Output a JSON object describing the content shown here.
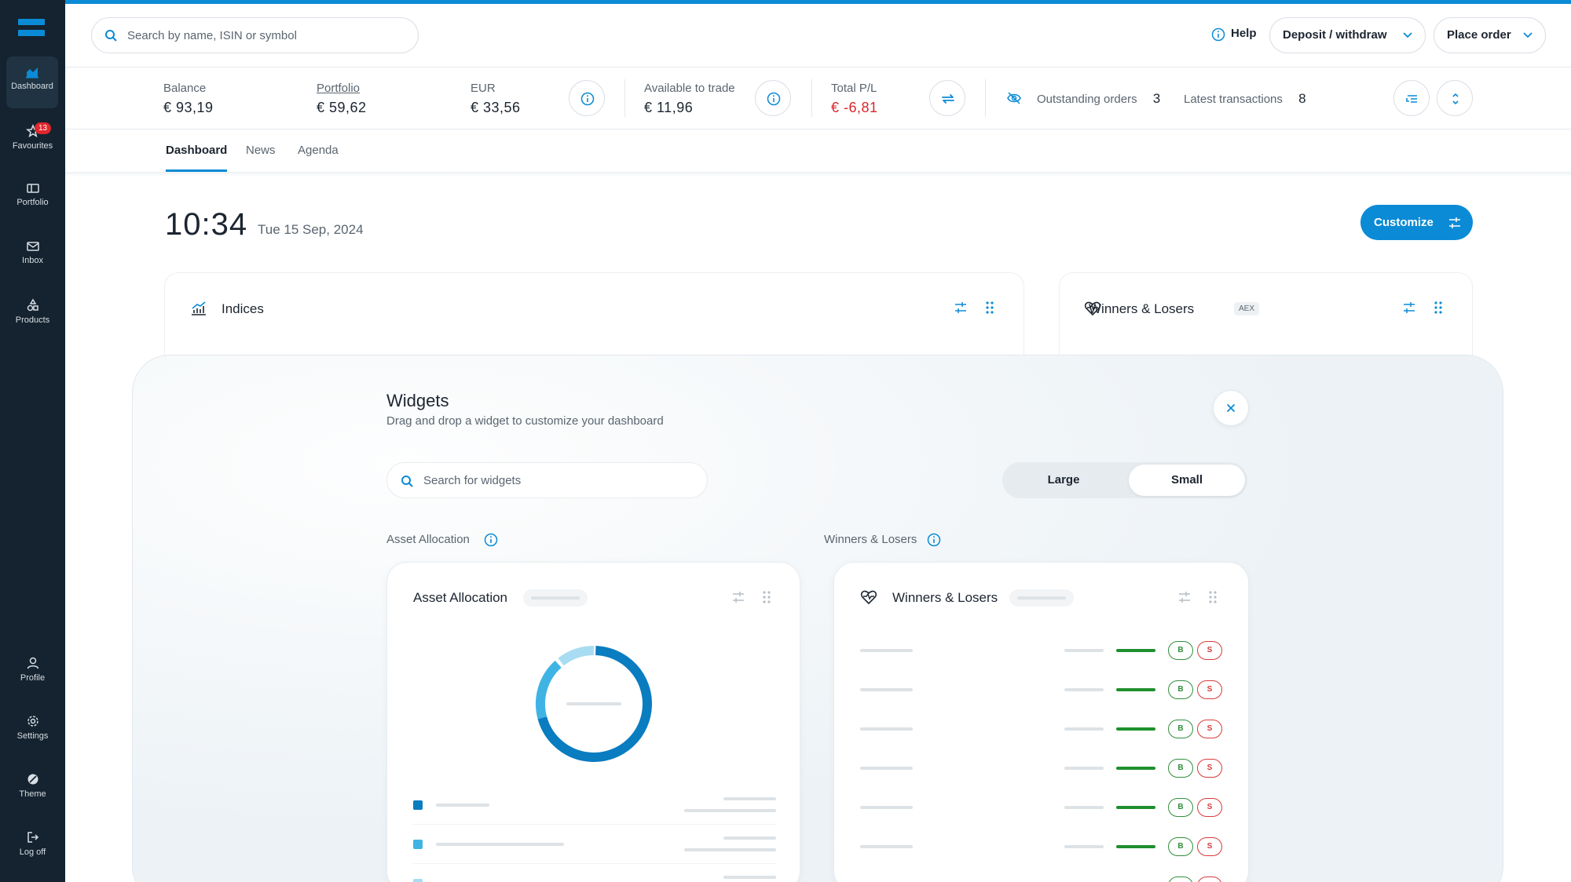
{
  "sidebar": {
    "items": [
      {
        "label": "Dashboard",
        "icon": "dashboard-icon"
      },
      {
        "label": "Favourites",
        "icon": "star-icon",
        "badge": "13"
      },
      {
        "label": "Portfolio",
        "icon": "portfolio-icon"
      },
      {
        "label": "Inbox",
        "icon": "inbox-icon"
      },
      {
        "label": "Products",
        "icon": "products-icon"
      }
    ],
    "bottom_items": [
      {
        "label": "Profile",
        "icon": "user-icon"
      },
      {
        "label": "Settings",
        "icon": "gear-icon"
      },
      {
        "label": "Theme",
        "icon": "theme-icon"
      },
      {
        "label": "Log off",
        "icon": "logout-icon"
      }
    ]
  },
  "header": {
    "search_placeholder": "Search by name, ISIN or symbol",
    "help": "Help",
    "deposit": "Deposit / withdraw",
    "place_order": "Place order"
  },
  "stats": {
    "balance_label": "Balance",
    "balance": "€ 93,19",
    "portfolio_label": "Portfolio",
    "portfolio": "€ 59,62",
    "eur_label": "EUR",
    "eur": "€ 33,56",
    "available_label": "Available to trade",
    "available": "€ 11,96",
    "pl_label": "Total P/L",
    "pl": "€ -6,81",
    "outstanding_label": "Outstanding orders",
    "outstanding": "3",
    "latest_label": "Latest transactions",
    "latest": "8"
  },
  "tabs": [
    "Dashboard",
    "News",
    "Agenda"
  ],
  "clock": {
    "time": "10:34",
    "date": "Tue 15 Sep, 2024"
  },
  "customize": "Customize",
  "cards": {
    "indices": "Indices",
    "winners": "Winners & Losers",
    "winners_tag": "AEX"
  },
  "widgets_panel": {
    "title": "Widgets",
    "subtitle": "Drag and drop a widget to customize your dashboard",
    "search_placeholder": "Search for widgets",
    "size_options": [
      "Large",
      "Small"
    ],
    "selected_size": "Small",
    "section_asset": "Asset Allocation",
    "section_winners": "Winners & Losers",
    "asset_card_title": "Asset Allocation",
    "winners_card_title": "Winners & Losers",
    "buy": "B",
    "sell": "S"
  },
  "colors": {
    "accent": "#0b8bd6",
    "sidebar": "#14232f",
    "negative": "#d9262c",
    "positive": "#1f8f2d"
  }
}
